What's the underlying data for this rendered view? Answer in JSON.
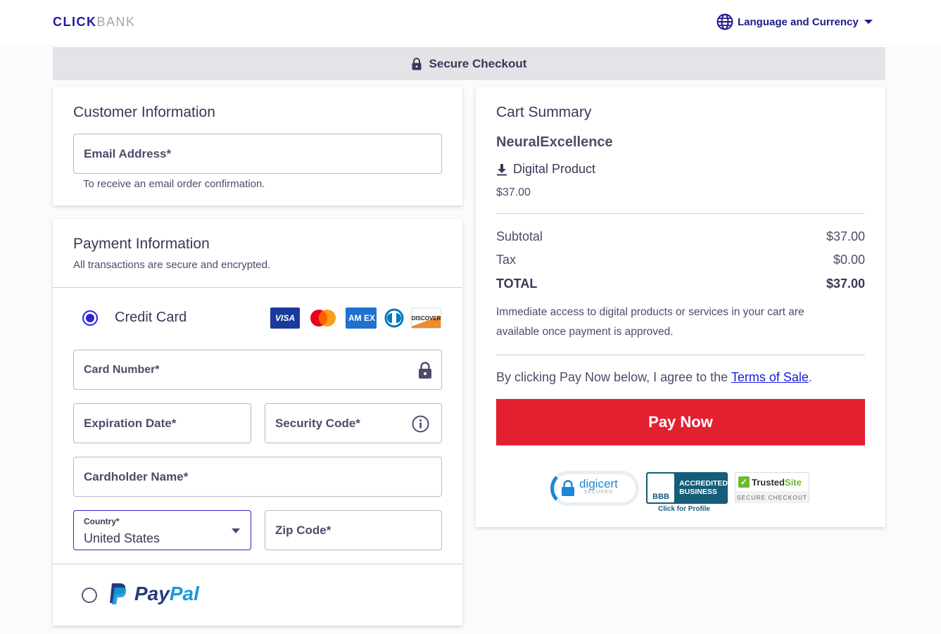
{
  "header": {
    "logo_part1": "CLICK",
    "logo_part2": "BANK",
    "language_currency": "Language and Currency"
  },
  "secure_bar": {
    "label": "Secure Checkout"
  },
  "customer": {
    "title": "Customer Information",
    "email_label": "Email Address*",
    "email_helper": "To receive an email order confirmation."
  },
  "payment": {
    "title": "Payment Information",
    "subtitle": "All transactions are secure and encrypted.",
    "credit_card_label": "Credit Card",
    "credit_card_selected": true,
    "card_brands": [
      "VISA",
      "Mastercard",
      "AMEX",
      "Diners Club",
      "DISCOVER"
    ],
    "visa_text": "VISA",
    "amex_text": "AM EX",
    "discover_text": "DISCOVER",
    "card_number_label": "Card Number*",
    "expiration_label": "Expiration Date*",
    "security_code_label": "Security Code*",
    "cardholder_label": "Cardholder Name*",
    "country_label": "Country*",
    "country_value": "United States",
    "zip_label": "Zip Code*",
    "paypal_pay": "Pay",
    "paypal_pal": "Pal",
    "paypal_selected": false
  },
  "cart": {
    "title": "Cart Summary",
    "product_name": "NeuralExcellence",
    "product_type": "Digital Product",
    "product_price": "$37.00",
    "subtotal_label": "Subtotal",
    "subtotal_value": "$37.00",
    "tax_label": "Tax",
    "tax_value": "$0.00",
    "total_label": "TOTAL",
    "total_value": "$37.00",
    "note": "Immediate access to digital products or services in your cart are available once payment is approved.",
    "agree_prefix": "By clicking Pay Now below, I agree to the ",
    "terms_link": "Terms of Sale",
    "agree_suffix": ".",
    "pay_now": "Pay Now"
  },
  "badges": {
    "digicert_name": "digicert",
    "digicert_sub": "SECURED",
    "bbb_logo": "BBB",
    "bbb_line1": "ACCREDITED",
    "bbb_line2": "BUSINESS",
    "bbb_sub": "Click for Profile",
    "trusted_a": "Trusted",
    "trusted_b": "Site",
    "trusted_sub": "SECURE CHECKOUT"
  },
  "colors": {
    "brand": "#1e1aa3",
    "pay_button": "#e32030",
    "radio_selected": "#2f22d8",
    "link": "#1a1ae0"
  }
}
